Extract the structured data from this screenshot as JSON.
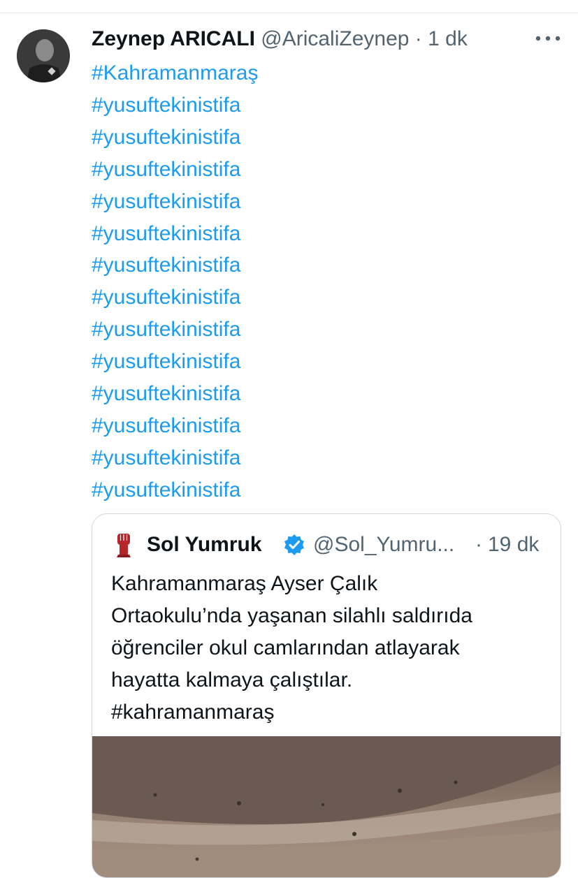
{
  "tweet": {
    "author_name": "Zeynep ARICALI",
    "author_handle": "@AricaliZeynep",
    "separator": "·",
    "time": "1 dk",
    "avatar_icon": "profile-photo",
    "more_icon": "more-horizontal-icon",
    "hashtags": [
      "#Kahramanmaraş",
      "#yusuftekinistifa",
      "#yusuftekinistifa",
      "#yusuftekinistifa",
      "#yusuftekinistifa",
      "#yusuftekinistifa",
      "#yusuftekinistifa",
      "#yusuftekinistifa",
      "#yusuftekinistifa",
      "#yusuftekinistifa",
      "#yusuftekinistifa",
      "#yusuftekinistifa",
      "#yusuftekinistifa",
      "#yusuftekinistifa"
    ]
  },
  "quote": {
    "author_name": "Sol Yumruk",
    "author_handle": "@Sol_Yumru...",
    "separator": "·",
    "time": "19 dk",
    "avatar_icon": "raised-fist-icon",
    "verified_icon": "verified-badge-icon",
    "text_lines": [
      "Kahramanmaraş Ayser Çalık",
      "Ortaokulu’nda yaşanan silahlı saldırıda",
      "öğrenciler okul camlarından atlayarak",
      "hayatta kalmaya çalıştılar."
    ],
    "hashtag": "#kahramanmaraş",
    "media_icon": "video-thumbnail"
  },
  "colors": {
    "link": "#1d9bf0",
    "secondary_text": "#536471",
    "primary_text": "#0f1419",
    "border": "#cfd9de",
    "verified": "#1d9bf0",
    "fist": "#b3262a"
  }
}
